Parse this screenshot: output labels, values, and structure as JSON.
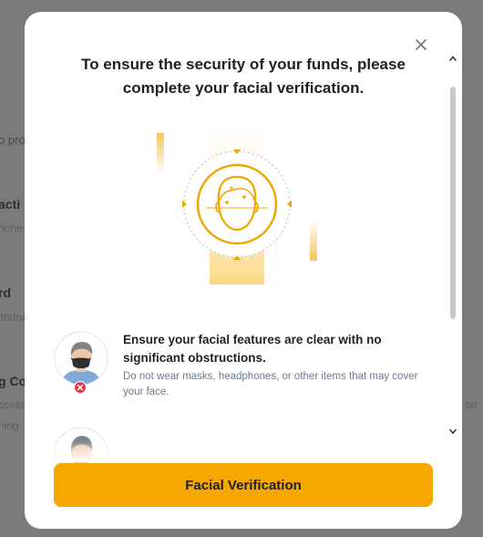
{
  "background": {
    "fragments": [
      "o pro",
      "acti",
      "hone",
      "rd",
      "ithdra",
      "g Co",
      "ccess",
      "ning",
      "bit"
    ]
  },
  "modal": {
    "title": "To ensure the security of your funds, please complete your facial verification.",
    "tips": [
      {
        "title": "Ensure your facial features are clear with no significant obstructions.",
        "description": "Do not wear masks, headphones, or other items that may cover your face."
      }
    ],
    "button_label": "Facial Verification"
  },
  "colors": {
    "accent": "#f6a700",
    "error": "#e8394a",
    "overlay": "#7b7b7b"
  },
  "icons": [
    "close-icon",
    "chevron-up-icon",
    "chevron-down-icon",
    "face-scan-icon",
    "masked-person-icon",
    "error-x-icon"
  ]
}
